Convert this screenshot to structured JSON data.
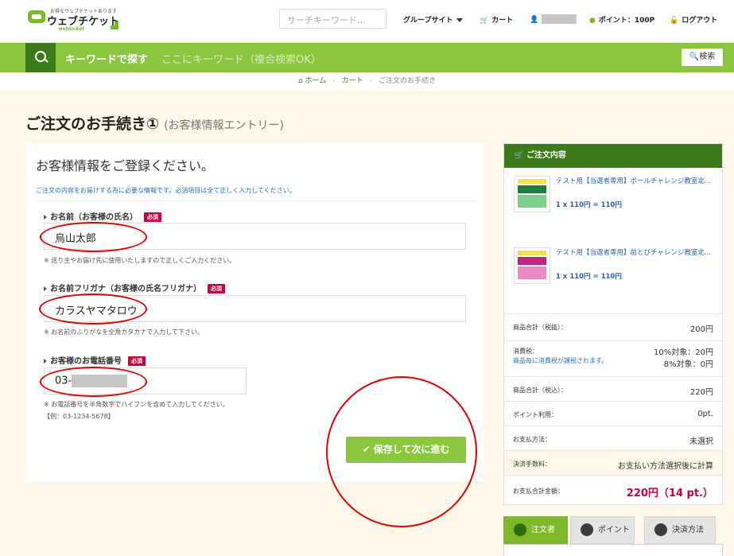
{
  "header": {
    "logo_tagline": "お得なウェブチケットあります",
    "logo_name": "ウェブチケット",
    "logo_sub": "webticket",
    "search_placeholder": "サーチキーワード…",
    "group_site": "グループサイト",
    "cart": "カート",
    "points": "ポイント：100P",
    "logout": "ログアウト"
  },
  "keyword_bar": {
    "label": "キーワードで探す",
    "placeholder": "ここにキーワード（複合検索OK）",
    "button": "検索"
  },
  "breadcrumb": {
    "home": "ホーム",
    "cart": "カート",
    "current": "ご注文のお手続き"
  },
  "page": {
    "title": "ご注文のお手続き①",
    "subtitle": "(お客様情報エントリー)"
  },
  "form": {
    "heading": "お客様情報をご登録ください。",
    "note": "ご注文の内容をお届けする為に必要な情報です。必須項目は全て正しく入力してください。",
    "required_label": "必須",
    "name": {
      "label": "お名前（お客様の氏名）",
      "value": "烏山太郎",
      "hint": "※ 送り主やお届け先に使用いたしますので正しくご入力ください。"
    },
    "kana": {
      "label": "お名前フリガナ（お客様の氏名フリガナ）",
      "value": "カラスヤマタロウ",
      "hint": "※ お名前のふりがなを全角カタカナで入力して下さい。"
    },
    "phone": {
      "label": "お客様のお電話番号",
      "value_prefix": "03-",
      "hint": "※ お電話番号を半角数字でハイフンを含めて入力してください。",
      "example": "【例：03-1234-5678】"
    },
    "submit": "保存して次に進む"
  },
  "order": {
    "heading": "ご注文内容",
    "items": [
      {
        "title": "テスト用【当選者専用】ボールチャレンジ教室北...",
        "qty": "1 x 110円 = 110円",
        "thumb_color": "#2e9a4a"
      },
      {
        "title": "テスト用【当選者専用】前とびチャレンジ教室北...",
        "qty": "1 x 110円 = 110円",
        "thumb_color": "#d0409a"
      }
    ],
    "subtotal_label": "商品合計（税抜）：",
    "subtotal": "200円",
    "tax_label": "消費税：",
    "tax_note": "商品毎に消費税が課税されます。",
    "tax_10": "10%対象：20円",
    "tax_8": "8%対象：0円",
    "total_incl_label": "商品合計（税込）：",
    "total_incl": "220円",
    "points_label": "ポイント利用：",
    "points": "0pt.",
    "payment_label": "お支払方法：",
    "payment": "未選択",
    "fee_label": "決済手数料：",
    "fee": "お支払い方法選択後に計算",
    "grand_label": "お支払合計金額：",
    "grand": "220円（14 pt.）"
  },
  "tabs": [
    {
      "label": "注文者"
    },
    {
      "label": "ポイント"
    },
    {
      "label": "決済方法"
    }
  ],
  "colors": {
    "accent": "#8cc63e",
    "dark_green": "#3c7a1b",
    "required": "#c8003c",
    "annotation": "#e00000"
  }
}
